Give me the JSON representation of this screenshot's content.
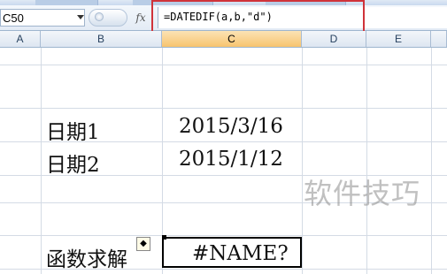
{
  "formula_bar": {
    "name_box_value": "C50",
    "fx_label": "fx",
    "formula": "=DATEDIF(a,b,\"d\")"
  },
  "columns": [
    "A",
    "B",
    "C",
    "D",
    "E"
  ],
  "active_column": "C",
  "cells": {
    "b_date1_label": "日期1",
    "c_date1_value": "2015/3/16",
    "b_date2_label": "日期2",
    "c_date2_value": "2015/1/12",
    "b_result_label": "函数求解",
    "c_result_value": "#NAME?"
  },
  "error_indicator_symbol": "◆",
  "watermark": "软件技巧",
  "colors": {
    "highlight_border": "#d0333a",
    "active_column_header": "#f7c46e",
    "gridline": "#d4dbe5"
  }
}
